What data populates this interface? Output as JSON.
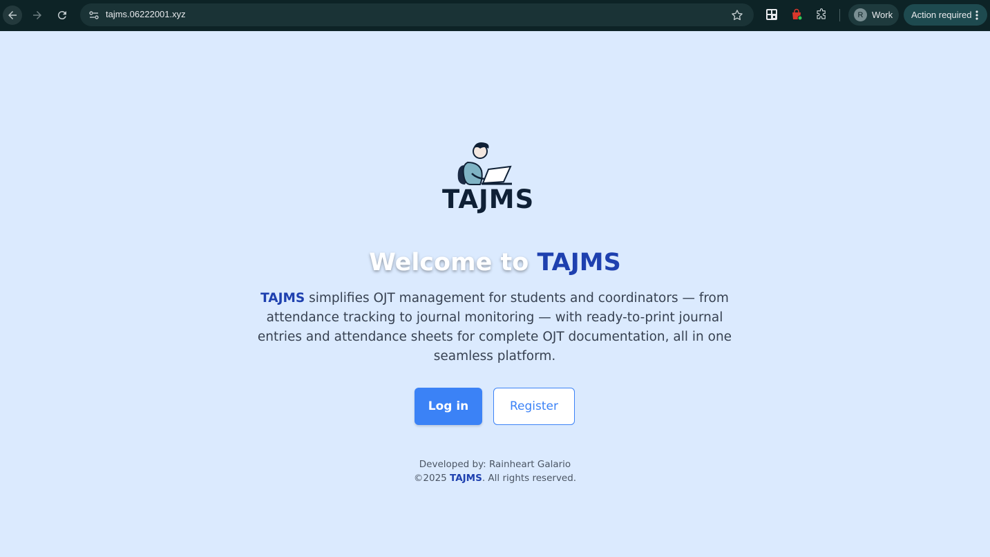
{
  "browser": {
    "url": "tajms.06222001.xyz",
    "profile_initial": "R",
    "profile_label": "Work",
    "action_label": "Action required",
    "icons": [
      "back-icon",
      "forward-icon",
      "reload-icon",
      "site-info-icon",
      "star-icon",
      "qr-code-icon",
      "shopping-bag-icon",
      "puzzle-icon",
      "more-vert-icon"
    ]
  },
  "logo": {
    "text": "TAJMS"
  },
  "hero": {
    "welcome_prefix": "Welcome to ",
    "welcome_brand": "TAJMS",
    "desc_brand": "TAJMS",
    "desc_rest": " simplifies OJT management for students and coordinators — from attendance tracking to journal monitoring — with ready-to-print journal entries and attendance sheets for complete OJT documentation, all in one seamless platform."
  },
  "buttons": {
    "login": "Log in",
    "register": "Register"
  },
  "footer": {
    "developed_by": "Developed by: Rainheart Galario",
    "copyright_prefix": "©2025 ",
    "copyright_brand": "TAJMS",
    "copyright_suffix": ". All rights reserved."
  },
  "colors": {
    "page_bg": "#dbeafe",
    "brand": "#1e40af",
    "primary": "#3b82f6",
    "chrome_bg": "#0d2326"
  }
}
